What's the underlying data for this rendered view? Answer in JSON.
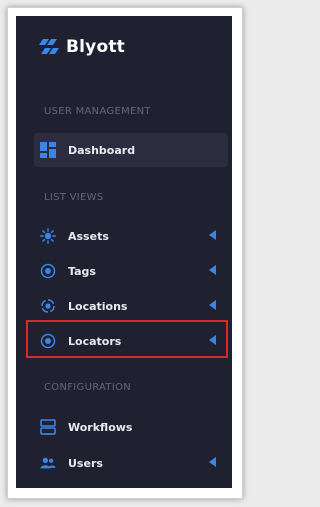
{
  "brand": {
    "name": "Blyott",
    "logo_icon": "blyott-logo-icon",
    "accent": "#3a86e8"
  },
  "sections": {
    "user_management": "USER MANAGEMENT",
    "list_views": "LIST VIEWS",
    "configuration": "CONFIGURATION"
  },
  "items": {
    "dashboard": {
      "label": "Dashboard",
      "icon": "dashboard-icon",
      "active": true
    },
    "assets": {
      "label": "Assets",
      "icon": "sun-icon",
      "has_submenu": true
    },
    "tags": {
      "label": "Tags",
      "icon": "target-icon",
      "has_submenu": true
    },
    "locations": {
      "label": "Locations",
      "icon": "crosshair-icon",
      "has_submenu": true
    },
    "locators": {
      "label": "Locators",
      "icon": "target-icon",
      "has_submenu": true,
      "highlighted": true
    },
    "workflows": {
      "label": "Workflows",
      "icon": "server-icon"
    },
    "users": {
      "label": "Users",
      "icon": "users-icon",
      "has_submenu": true
    }
  },
  "colors": {
    "sidebar_bg": "#1f2131",
    "highlight_border": "#d62a2a",
    "icon_blue": "#3a86e8"
  }
}
